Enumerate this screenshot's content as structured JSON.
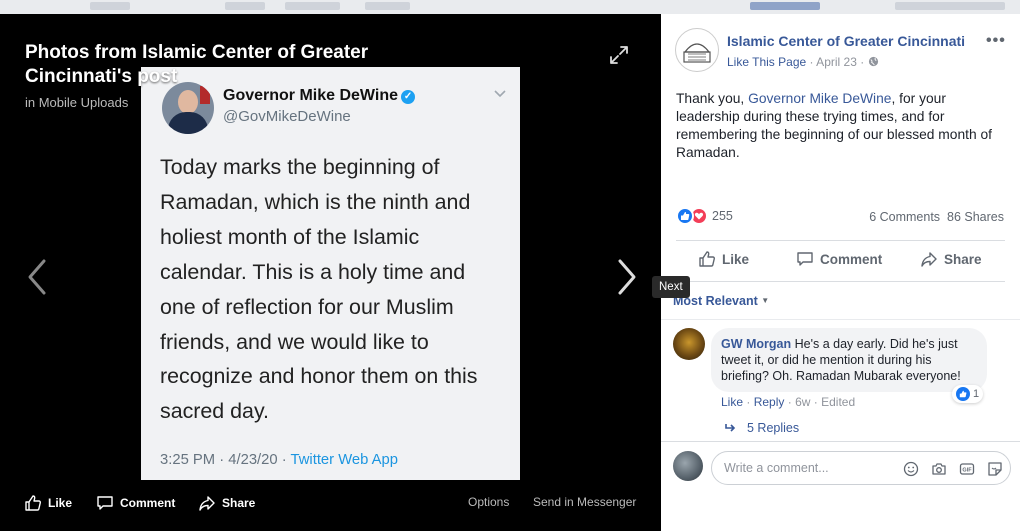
{
  "viewer": {
    "title": "Photos from Islamic Center of Greater Cincinnati's post",
    "subtitle": "in Mobile Uploads",
    "tooltip": "Next",
    "footer": {
      "like": "Like",
      "comment": "Comment",
      "share": "Share",
      "options": "Options",
      "send_in_messenger": "Send in Messenger"
    }
  },
  "tweet": {
    "name": "Governor Mike DeWine",
    "verified_mark": "✓",
    "handle": "@GovMikeDeWine",
    "body": "Today marks the beginning of Ramadan, which is the ninth and holiest month of the Islamic calendar. This is a holy time and one of reflection for our Muslim friends, and we would like to recognize and honor them on this sacred day.",
    "time_date": "3:25 PM · 4/23/20 · ",
    "app": "Twitter Web App"
  },
  "post": {
    "page_name": "Islamic Center of Greater Cincinnati",
    "like_page": "Like This Page",
    "date": "· April 23 ·",
    "more": "•••",
    "text_before": "Thank you, ",
    "mention": "Governor Mike DeWine",
    "text_after": ", for your leadership during these trying times, and for remembering the beginning of our blessed month of Ramadan.",
    "reaction_count": "255",
    "comments_count": "6 Comments",
    "shares_count": "86 Shares",
    "actions": {
      "like": "Like",
      "comment": "Comment",
      "share": "Share"
    },
    "sort": "Most Relevant"
  },
  "comment": {
    "author": "GW Morgan",
    "text": "He's a day early. Did he's just tweet it, or did he mention it during his briefing? Oh. Ramadan Mubarak everyone!",
    "reaction_count": "1",
    "like": "Like",
    "reply": "Reply",
    "age": "6w",
    "edited": "Edited",
    "sep": "·",
    "replies": "5 Replies"
  },
  "composer": {
    "placeholder": "Write a comment..."
  },
  "colors": {
    "link_blue": "#385898",
    "facebook_blue": "#1877f2",
    "love_red": "#f33e58",
    "twitter_blue": "#1da1f2"
  },
  "icons": [
    "expand-icon",
    "chevron-left-icon",
    "chevron-right-icon",
    "thumbs-up-icon",
    "comment-icon",
    "share-icon",
    "verified-icon",
    "globe-icon",
    "reply-arrow-icon",
    "emoji-icon",
    "camera-icon",
    "gif-icon",
    "sticker-icon",
    "heart-icon"
  ]
}
